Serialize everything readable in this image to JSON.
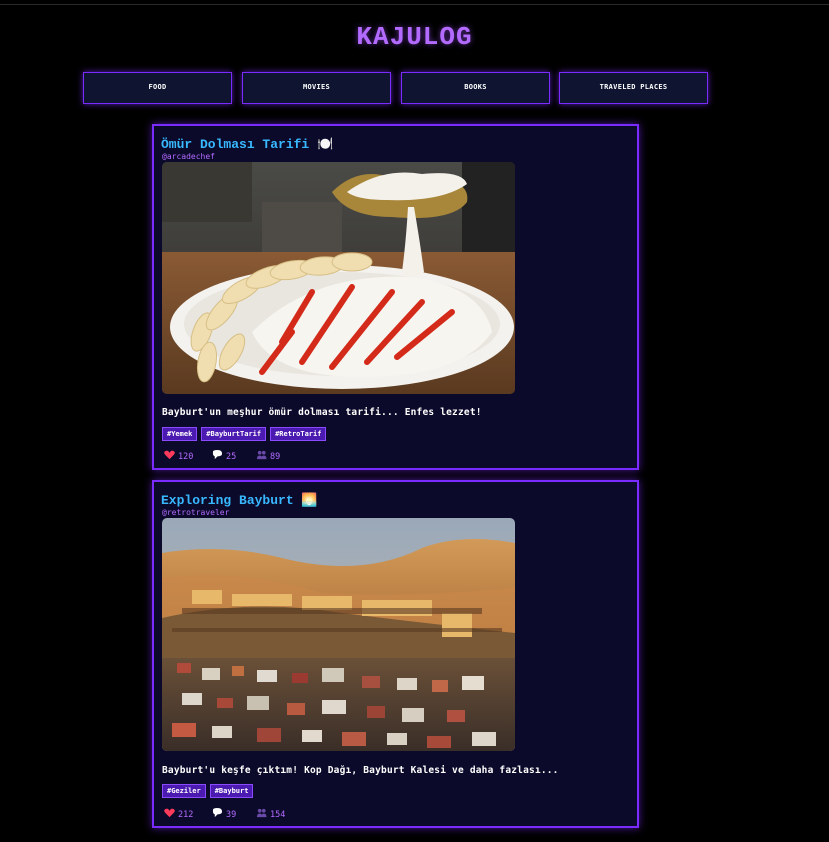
{
  "app": {
    "title": "KAJULOG"
  },
  "nav": [
    {
      "label": "FOOD"
    },
    {
      "label": "MOVIES"
    },
    {
      "label": "BOOKS"
    },
    {
      "label": "TRAVELED PLACES"
    }
  ],
  "posts": [
    {
      "title": "Ömür Dolması Tarifi 🍽️",
      "user": "@arcadechef",
      "image": "food-photo",
      "text": "Bayburt'un meşhur ömür dolması tarifi... Enfes lezzet!",
      "tags": [
        "#Yemek",
        "#BayburtTarif",
        "#RetroTarif"
      ],
      "likes": "120",
      "comments": "25",
      "views": "89"
    },
    {
      "title": "Exploring Bayburt 🌅",
      "user": "@retrotraveler",
      "image": "landscape-photo",
      "text": "Bayburt'u keşfe çıktım! Kop Dağı, Bayburt Kalesi ve daha fazlası...",
      "tags": [
        "#Geziler",
        "#Bayburt"
      ],
      "likes": "212",
      "comments": "39",
      "views": "154"
    }
  ],
  "colors": {
    "accent": "#7a2cff",
    "title": "#b36bff",
    "link": "#38b8ff",
    "heart": "#ff3b5c"
  }
}
